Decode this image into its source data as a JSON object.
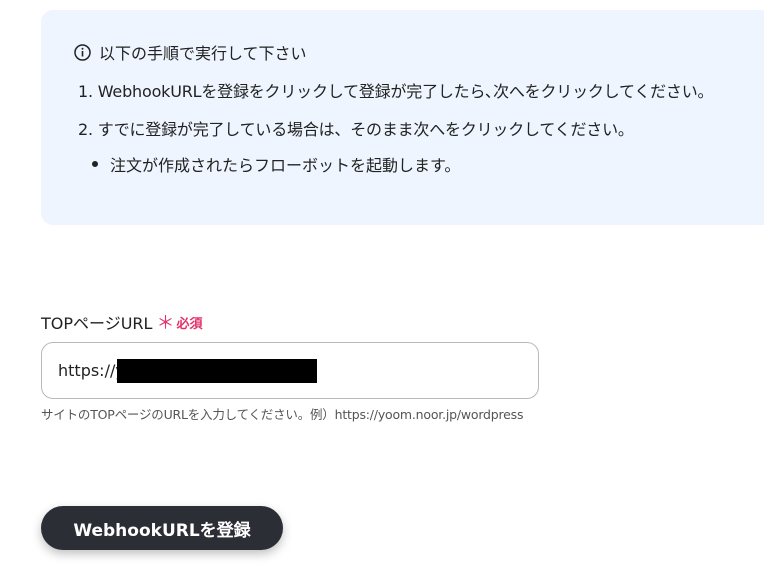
{
  "info_box": {
    "header": "以下の手順で実行して下さい",
    "steps": [
      "1. WebhookURLを登録をクリックして登録が完了したら､次へをクリックしてください。",
      "2. すでに登録が完了している場合は、そのまま次へをクリックしてください。"
    ],
    "bullets": [
      "注文が作成されたらフローボットを起動します。"
    ],
    "icon": "info-circle-icon"
  },
  "field": {
    "label": "TOPページURL",
    "required_mark": "＊",
    "required_text": "必須",
    "value": "https://y",
    "helper": "サイトのTOPページのURLを入力してください。例）https://yoom.noor.jp/wordpress"
  },
  "button": {
    "label": "WebhookURLを登録"
  },
  "colors": {
    "info_bg": "#eef5fe",
    "required": "#e0336a",
    "button_bg": "#2b2e34"
  }
}
